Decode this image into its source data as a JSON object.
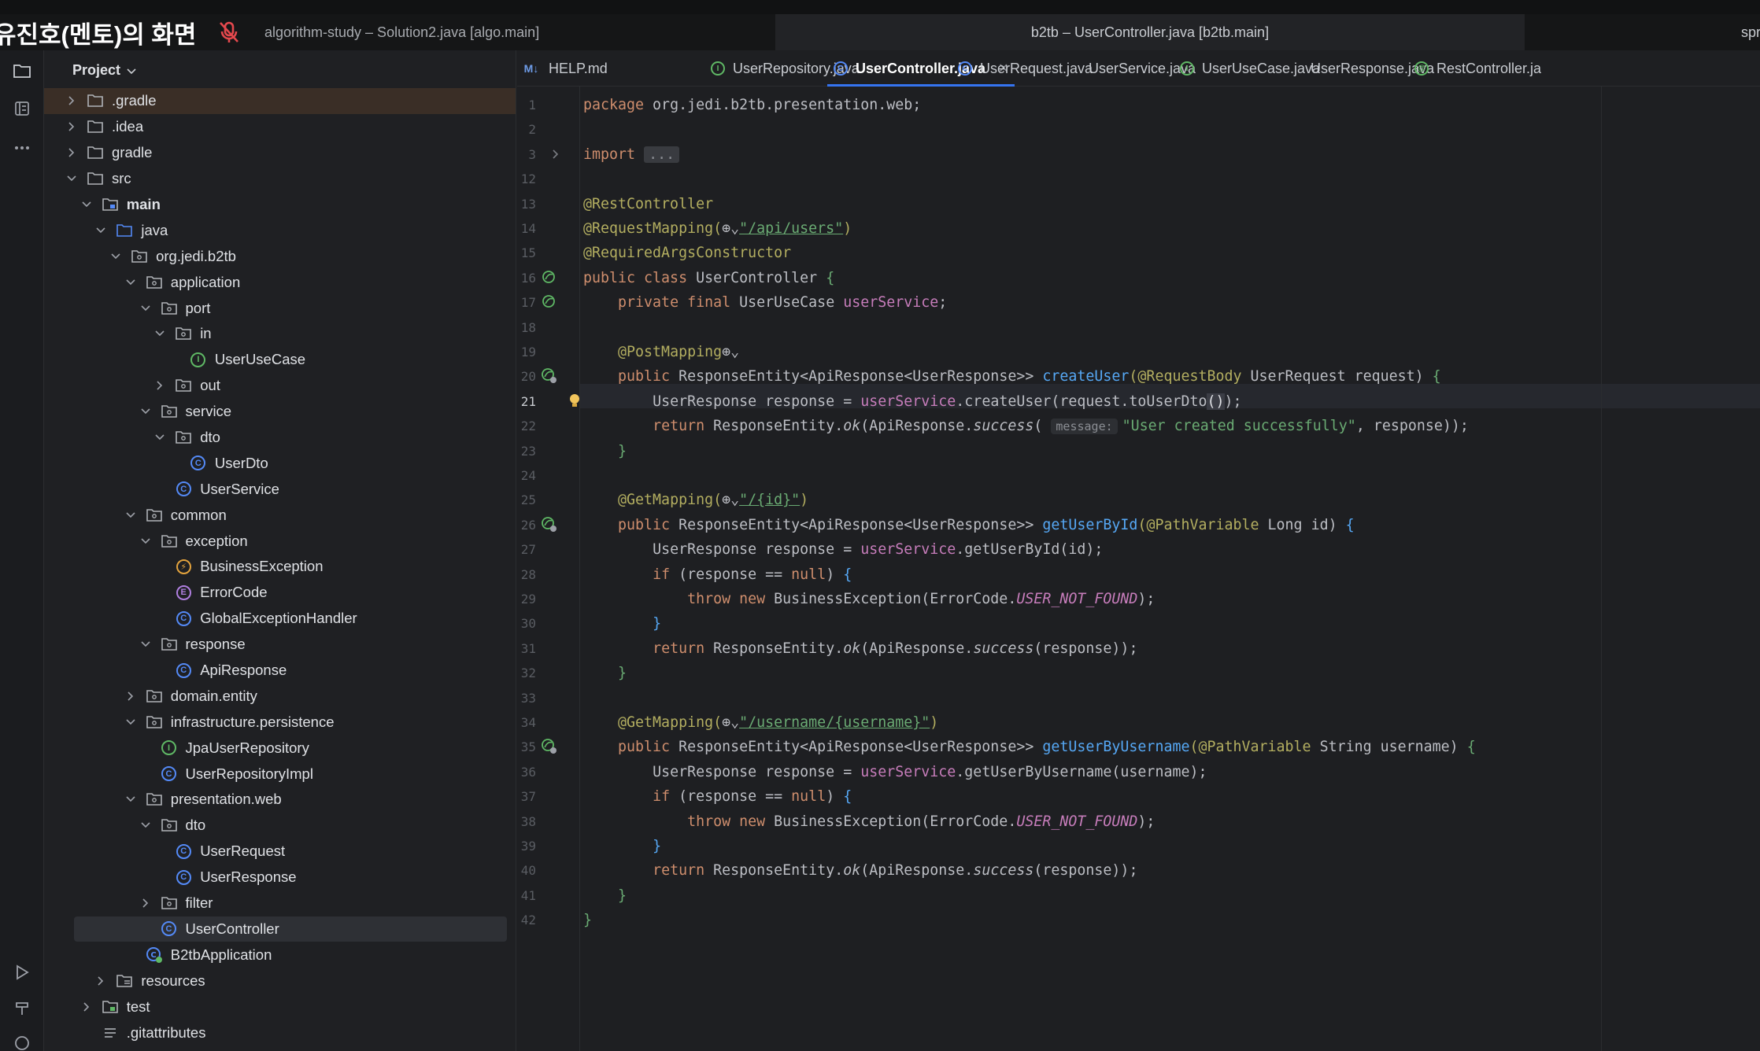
{
  "presenter": {
    "label": "유진호(멘토)의 화면"
  },
  "window_tabs": [
    {
      "label": "algorithm-study – Solution2.java [algo.main]"
    },
    {
      "label": "b2tb – UserController.java [b2tb.main]"
    },
    {
      "label": "spr"
    }
  ],
  "project": {
    "title": "Project",
    "tree": [
      {
        "depth": 0,
        "label": ".gradle",
        "icon": "folder",
        "chev": "right"
      },
      {
        "depth": 0,
        "label": ".idea",
        "icon": "folder",
        "chev": "right"
      },
      {
        "depth": 0,
        "label": "gradle",
        "icon": "folder",
        "chev": "right"
      },
      {
        "depth": 0,
        "label": "src",
        "icon": "folder",
        "chev": "down"
      },
      {
        "depth": 1,
        "label": "main",
        "icon": "source-folder",
        "chev": "down"
      },
      {
        "depth": 2,
        "label": "java",
        "icon": "java-folder",
        "chev": "down"
      },
      {
        "depth": 3,
        "label": "org.jedi.b2tb",
        "icon": "package",
        "chev": "down"
      },
      {
        "depth": 4,
        "label": "application",
        "icon": "package",
        "chev": "down"
      },
      {
        "depth": 5,
        "label": "port",
        "icon": "package",
        "chev": "down"
      },
      {
        "depth": 6,
        "label": "in",
        "icon": "package",
        "chev": "down"
      },
      {
        "depth": 7,
        "label": "UserUseCase",
        "icon": "interface",
        "chev": "none"
      },
      {
        "depth": 6,
        "label": "out",
        "icon": "package",
        "chev": "right"
      },
      {
        "depth": 5,
        "label": "service",
        "icon": "package",
        "chev": "down"
      },
      {
        "depth": 6,
        "label": "dto",
        "icon": "package",
        "chev": "down"
      },
      {
        "depth": 7,
        "label": "UserDto",
        "icon": "class",
        "chev": "none"
      },
      {
        "depth": 6,
        "label": "UserService",
        "icon": "class",
        "chev": "none"
      },
      {
        "depth": 4,
        "label": "common",
        "icon": "package",
        "chev": "down"
      },
      {
        "depth": 5,
        "label": "exception",
        "icon": "package",
        "chev": "down"
      },
      {
        "depth": 6,
        "label": "BusinessException",
        "icon": "exception",
        "chev": "none"
      },
      {
        "depth": 6,
        "label": "ErrorCode",
        "icon": "enum",
        "chev": "none"
      },
      {
        "depth": 6,
        "label": "GlobalExceptionHandler",
        "icon": "class",
        "chev": "none"
      },
      {
        "depth": 5,
        "label": "response",
        "icon": "package",
        "chev": "down"
      },
      {
        "depth": 6,
        "label": "ApiResponse",
        "icon": "class",
        "chev": "none"
      },
      {
        "depth": 4,
        "label": "domain.entity",
        "icon": "package",
        "chev": "right"
      },
      {
        "depth": 4,
        "label": "infrastructure.persistence",
        "icon": "package",
        "chev": "down"
      },
      {
        "depth": 5,
        "label": "JpaUserRepository",
        "icon": "interface",
        "chev": "none"
      },
      {
        "depth": 5,
        "label": "UserRepositoryImpl",
        "icon": "class",
        "chev": "none"
      },
      {
        "depth": 4,
        "label": "presentation.web",
        "icon": "package",
        "chev": "down"
      },
      {
        "depth": 5,
        "label": "dto",
        "icon": "package",
        "chev": "down"
      },
      {
        "depth": 6,
        "label": "UserRequest",
        "icon": "class",
        "chev": "none"
      },
      {
        "depth": 6,
        "label": "UserResponse",
        "icon": "class",
        "chev": "none"
      },
      {
        "depth": 5,
        "label": "filter",
        "icon": "package",
        "chev": "right"
      },
      {
        "depth": 5,
        "label": "UserController",
        "icon": "class",
        "chev": "none",
        "selected": true
      },
      {
        "depth": 4,
        "label": "B2tbApplication",
        "icon": "spring-class",
        "chev": "none"
      },
      {
        "depth": 2,
        "label": "resources",
        "icon": "resources-folder",
        "chev": "right"
      },
      {
        "depth": 1,
        "label": "test",
        "icon": "test-folder",
        "chev": "right"
      },
      {
        "depth": 1,
        "label": ".gitattributes",
        "icon": "text-file",
        "chev": "none"
      }
    ]
  },
  "editor_tabs": [
    {
      "label": "HELP.md",
      "icon": "markdown"
    },
    {
      "label": "UserRepository.java",
      "icon": "interface"
    },
    {
      "label": "UserController.java",
      "icon": "class",
      "active": true
    },
    {
      "label": "UserRequest.java",
      "icon": "class"
    },
    {
      "label": "UserService.java",
      "icon": "none"
    },
    {
      "label": "UserUseCase.java",
      "icon": "interface"
    },
    {
      "label": "UserResponse.java",
      "icon": "none"
    },
    {
      "label": "RestController.ja",
      "icon": "annotation"
    }
  ],
  "editor": {
    "line_numbers": [
      "1",
      "2",
      "3",
      "12",
      "13",
      "14",
      "15",
      "16",
      "17",
      "18",
      "19",
      "20",
      "21",
      "22",
      "23",
      "24",
      "25",
      "26",
      "27",
      "28",
      "29",
      "30",
      "31",
      "32",
      "33",
      "34",
      "35",
      "36",
      "37",
      "38",
      "39",
      "40",
      "41",
      "42"
    ],
    "current_line": "21",
    "code": {
      "l1": {
        "kw": "package",
        "rest": " org.jedi.b2tb.presentation.web;"
      },
      "l3": {
        "kw": "import",
        "fold": "..."
      },
      "l13": "@RestController",
      "l14": {
        "ann": "@RequestMapping(",
        "globe": "⊕⌄",
        "str": "\"/api/users\"",
        "close": ")"
      },
      "l15": "@RequiredArgsConstructor",
      "l16": {
        "kw": "public class",
        "name": " UserController ",
        "brace": "{"
      },
      "l17": {
        "kw": "private final",
        "type": " UserUseCase ",
        "field": "userService",
        "end": ";"
      },
      "l19": {
        "ann": "@PostMapping",
        "globe": "⊕⌄"
      },
      "l20": {
        "kw": "public",
        "type": " ResponseEntity<ApiResponse<UserResponse>> ",
        "fn": "createUser",
        "ann": "(@RequestBody",
        "rest": " UserRequest request) ",
        "brace": "{"
      },
      "l21": {
        "a": "UserResponse response = ",
        "field": "userService",
        "b": ".createUser(request.toUserDto",
        "paren": "()",
        "c": ");"
      },
      "l22": {
        "kw": "return",
        "a": " ResponseEntity.",
        "ok": "ok",
        "b": "(ApiResponse.",
        "succ": "success",
        "c": "( ",
        "hint": "message:",
        "str": "\"User created successfully\"",
        "d": ", response));"
      },
      "l23": "}",
      "l25": {
        "ann": "@GetMapping(",
        "globe": "⊕⌄",
        "str": "\"/{id}\"",
        "close": ")"
      },
      "l26": {
        "kw": "public",
        "type": " ResponseEntity<ApiResponse<UserResponse>> ",
        "fn": "getUserById",
        "ann": "(@PathVariable",
        "rest": " Long id) ",
        "brace": "{"
      },
      "l27": {
        "a": "UserResponse response = ",
        "field": "userService",
        "b": ".getUserById(id);"
      },
      "l28": {
        "kw": "if",
        "a": " (response == ",
        "nul": "null",
        "b": ") ",
        "brace": "{"
      },
      "l29": {
        "kw": "throw new",
        "a": " BusinessException(ErrorCode.",
        "const": "USER_NOT_FOUND",
        "b": ");"
      },
      "l30": "}",
      "l31": {
        "kw": "return",
        "a": " ResponseEntity.",
        "ok": "ok",
        "b": "(ApiResponse.",
        "succ": "success",
        "c": "(response));"
      },
      "l32": "}",
      "l34": {
        "ann": "@GetMapping(",
        "globe": "⊕⌄",
        "str": "\"/username/{username}\"",
        "close": ")"
      },
      "l35": {
        "kw": "public",
        "type": " ResponseEntity<ApiResponse<UserResponse>> ",
        "fn": "getUserByUsername",
        "ann": "(@PathVariable",
        "rest": " String username) ",
        "brace": "{"
      },
      "l36": {
        "a": "UserResponse response = ",
        "field": "userService",
        "b": ".getUserByUsername(username);"
      },
      "l37": {
        "kw": "if",
        "a": " (response == ",
        "nul": "null",
        "b": ") ",
        "brace": "{"
      },
      "l38": {
        "kw": "throw new",
        "a": " BusinessException(ErrorCode.",
        "const": "USER_NOT_FOUND",
        "b": ");"
      },
      "l39": "}",
      "l40": {
        "kw": "return",
        "a": " ResponseEntity.",
        "ok": "ok",
        "b": "(ApiResponse.",
        "succ": "success",
        "c": "(response));"
      },
      "l41": "}",
      "l42": "}"
    }
  }
}
